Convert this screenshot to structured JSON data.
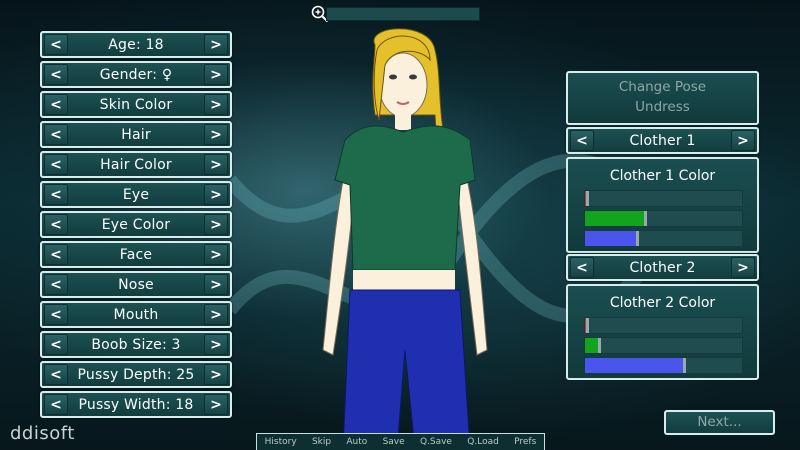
{
  "zoom": {
    "icon": "zoom-in-icon",
    "level": 0
  },
  "left_rows": [
    {
      "label": "Age: 18"
    },
    {
      "label": "Gender: ♀"
    },
    {
      "label": "Skin Color"
    },
    {
      "label": "Hair"
    },
    {
      "label": "Hair Color"
    },
    {
      "label": "Eye"
    },
    {
      "label": "Eye Color"
    },
    {
      "label": "Face"
    },
    {
      "label": "Nose"
    },
    {
      "label": "Mouth"
    },
    {
      "label": "Boob Size: 3"
    },
    {
      "label": "Pussy Depth: 25"
    },
    {
      "label": "Pussy Width: 18"
    }
  ],
  "arrows": {
    "prev": "<",
    "next": ">"
  },
  "right_panel": {
    "pose_actions": [
      "Change Pose",
      "Undress"
    ],
    "clother1": {
      "label": "Clother 1"
    },
    "clother1_color": {
      "title": "Clother 1 Color",
      "sliders": [
        {
          "channel": "red",
          "value": 0.01,
          "color": "#c43a3a"
        },
        {
          "channel": "green",
          "value": 0.38,
          "color": "#12a41c"
        },
        {
          "channel": "blue",
          "value": 0.33,
          "color": "#4a55ee"
        }
      ]
    },
    "clother2": {
      "label": "Clother 2"
    },
    "clother2_color": {
      "title": "Clother 2 Color",
      "sliders": [
        {
          "channel": "red",
          "value": 0.01,
          "color": "#c43a3a"
        },
        {
          "channel": "green",
          "value": 0.09,
          "color": "#12a41c"
        },
        {
          "channel": "blue",
          "value": 0.63,
          "color": "#4a55ee"
        }
      ]
    }
  },
  "next_label": "Next...",
  "brand": "ddisoft",
  "quick_menu": [
    "History",
    "Skip",
    "Auto",
    "Save",
    "Q.Save",
    "Q.Load",
    "Prefs"
  ],
  "colors": {
    "hair": "#e4c12a",
    "shirt": "#1d6b4a",
    "jeans": "#1f2fb0",
    "skin": "#fbf0dc"
  }
}
